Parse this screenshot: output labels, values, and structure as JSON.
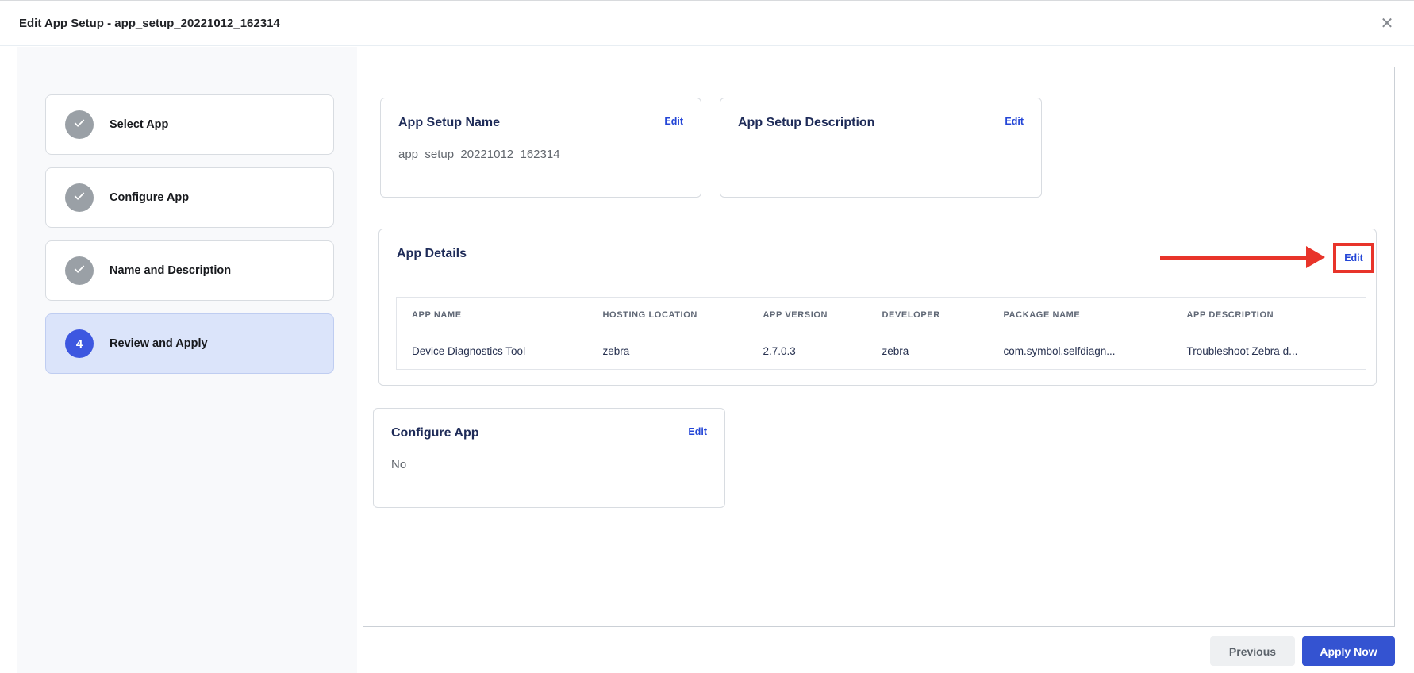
{
  "header": {
    "title": "Edit App Setup - app_setup_20221012_162314",
    "close_glyph": "✕"
  },
  "stepper": {
    "steps": [
      {
        "label": "Select App",
        "status": "completed"
      },
      {
        "label": "Configure App",
        "status": "completed"
      },
      {
        "label": "Name and Description",
        "status": "completed"
      },
      {
        "label": "Review and Apply",
        "status": "active",
        "number": "4"
      }
    ]
  },
  "review": {
    "app_setup_name": {
      "title": "App Setup Name",
      "edit_label": "Edit",
      "value": "app_setup_20221012_162314"
    },
    "app_setup_description": {
      "title": "App Setup Description",
      "edit_label": "Edit",
      "value": ""
    },
    "app_details": {
      "title": "App Details",
      "edit_label": "Edit",
      "table": {
        "columns": [
          "APP NAME",
          "HOSTING LOCATION",
          "APP VERSION",
          "DEVELOPER",
          "PACKAGE NAME",
          "APP DESCRIPTION"
        ],
        "rows": [
          [
            "Device Diagnostics Tool",
            "zebra",
            "2.7.0.3",
            "zebra",
            "com.symbol.selfdiagn...",
            "Troubleshoot Zebra d..."
          ]
        ]
      }
    },
    "configure_app": {
      "title": "Configure App",
      "edit_label": "Edit",
      "value": "No"
    }
  },
  "footer": {
    "previous_label": "Previous",
    "apply_label": "Apply Now"
  },
  "annotation": {
    "type": "red-arrow-and-box-highlight",
    "target": "app-details-edit-link",
    "color": "#e8342a"
  },
  "colors": {
    "active_step_bg": "#dbe4fa",
    "active_step_circle": "#3d57e0",
    "completed_step_circle": "#9aa0a6",
    "edit_link": "#2446d7",
    "apply_button_bg": "#3453d1",
    "heading_text": "#1e2b58",
    "sidebar_bg": "#f8f9fb"
  }
}
